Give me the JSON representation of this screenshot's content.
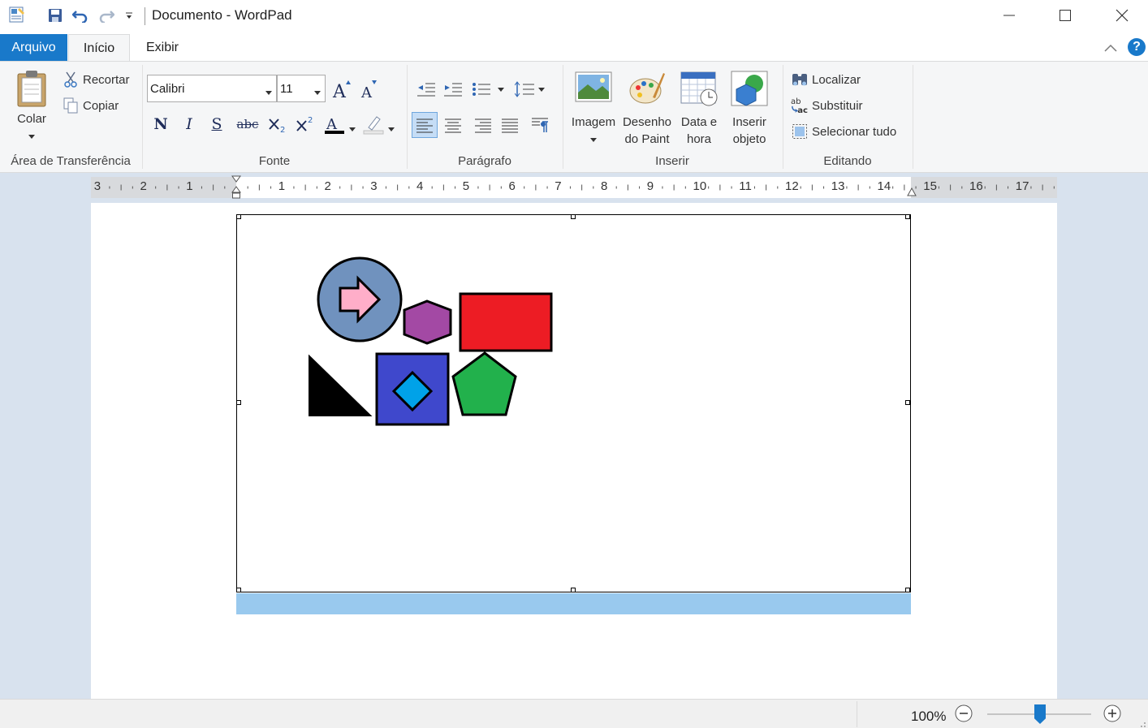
{
  "window": {
    "title": "Documento - WordPad"
  },
  "tabs": [
    {
      "label": "Arquivo"
    },
    {
      "label": "Início"
    },
    {
      "label": "Exibir"
    }
  ],
  "ribbon": {
    "clipboard": {
      "paste": "Colar",
      "cut": "Recortar",
      "copy": "Copiar",
      "group": "Área de Transferência"
    },
    "font": {
      "family": "Calibri",
      "size": "11",
      "group": "Fonte",
      "bold": "N",
      "italic": "I",
      "underline": "S",
      "strike": "abc",
      "color_letter": "A"
    },
    "paragraph": {
      "group": "Parágrafo"
    },
    "insert": {
      "image": "Imagem",
      "paint_1": "Desenho",
      "paint_2": "do Paint",
      "datetime_1": "Data e",
      "datetime_2": "hora",
      "object_1": "Inserir",
      "object_2": "objeto",
      "group": "Inserir"
    },
    "editing": {
      "find": "Localizar",
      "replace": "Substituir",
      "select_all": "Selecionar tudo",
      "group": "Editando"
    }
  },
  "ruler": {
    "left_numbers": [
      "3",
      "2",
      "1"
    ],
    "right_numbers": [
      "1",
      "2",
      "3",
      "4",
      "5",
      "6",
      "7",
      "8",
      "9",
      "10",
      "11",
      "12",
      "13",
      "14",
      "15",
      "16",
      "17"
    ]
  },
  "status": {
    "zoom": "100%",
    "zoom_fraction": 0.5
  },
  "colors": {
    "accent": "#1979ca",
    "selection": "#99c9ee",
    "circle": "#7092be",
    "arrow": "#ffaec9",
    "hexagon": "#a349a4",
    "rectangle": "#ed1c24",
    "triangle": "#000000",
    "square": "#3f48cc",
    "diamond": "#00a2e8",
    "pentagon": "#22b14c"
  }
}
